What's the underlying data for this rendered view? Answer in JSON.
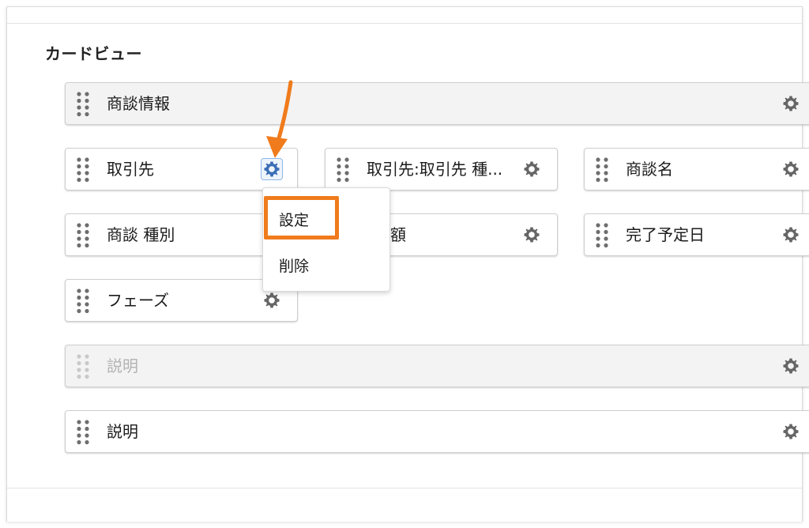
{
  "section": {
    "title": "カードビュー"
  },
  "cards": {
    "deal_info": "商談情報",
    "account": "取引先",
    "account_type": "取引先:取引先 種...",
    "deal_name": "商談名",
    "deal_type": "商談 種別",
    "amount": "額",
    "close_date": "完了予定日",
    "phase": "フェーズ",
    "description_muted": "説明",
    "description": "説明"
  },
  "context_menu": {
    "settings": "設定",
    "delete": "削除"
  },
  "colors": {
    "highlight": "#f07b1c",
    "arrow": "#f07b1c",
    "active_gear": "#3b6fb6"
  }
}
